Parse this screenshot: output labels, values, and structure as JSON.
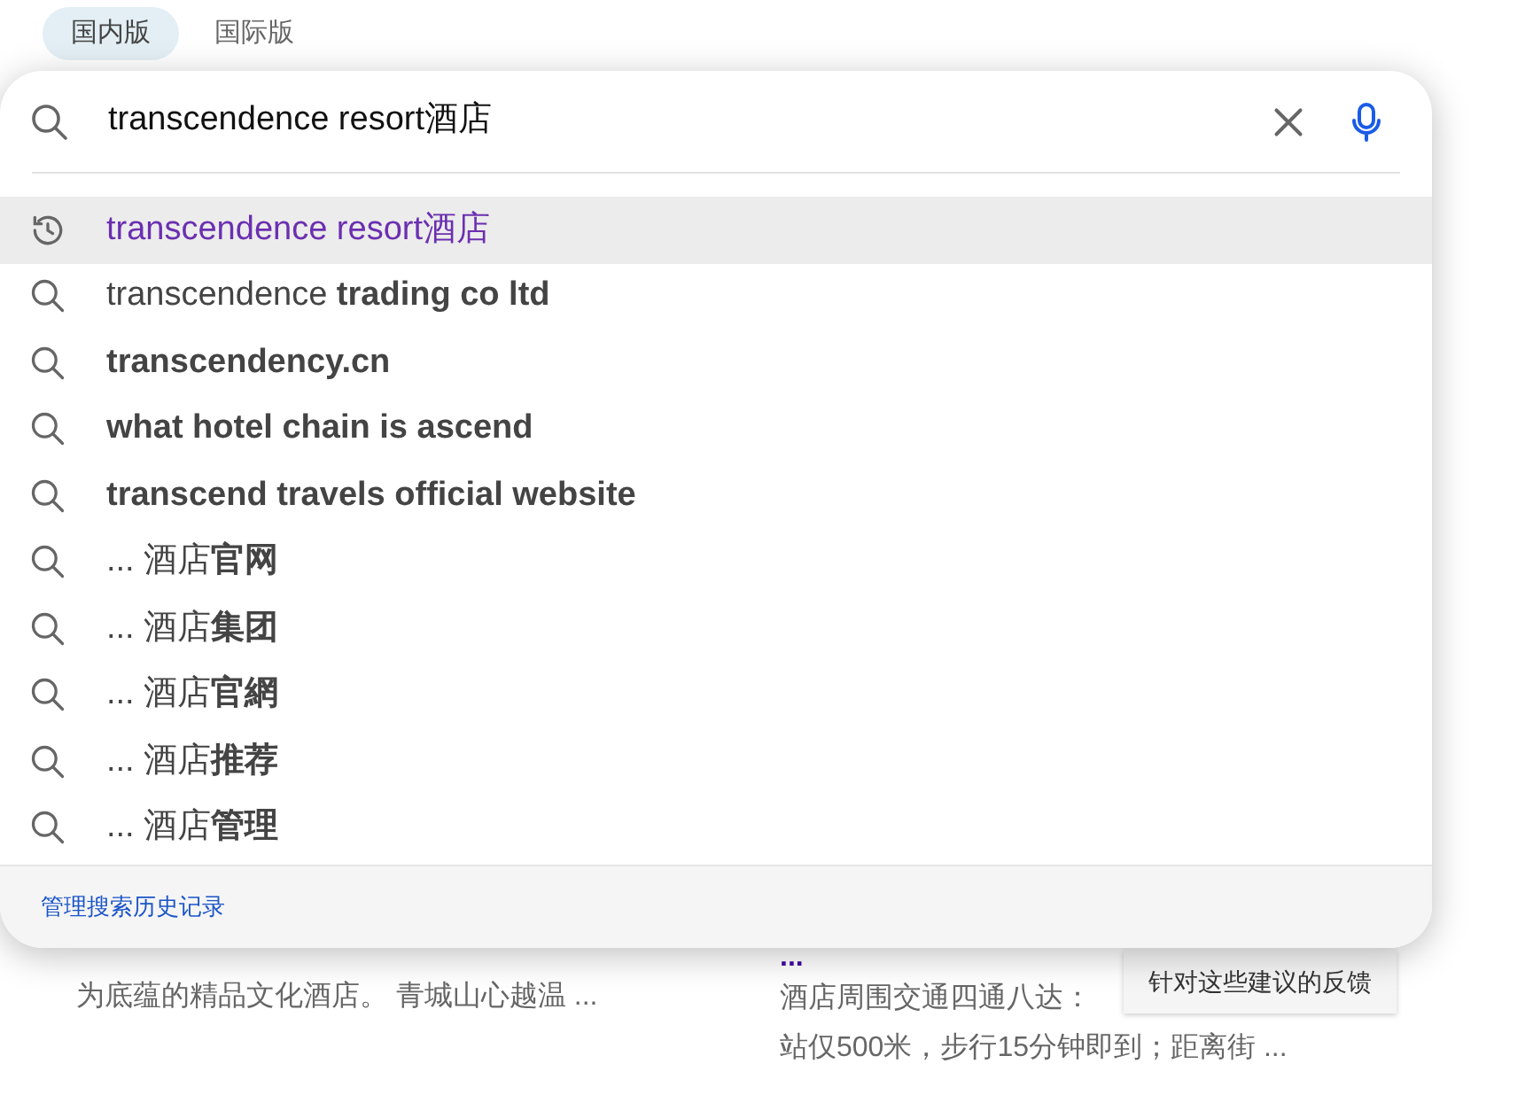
{
  "tabs": [
    {
      "label": "国内版",
      "selected": true
    },
    {
      "label": "国际版",
      "selected": false
    }
  ],
  "search": {
    "value": "transcendence resort酒店"
  },
  "suggestions": [
    {
      "kind": "history",
      "text": "transcendence resort酒店",
      "selected": true
    },
    {
      "kind": "search",
      "text": "transcendence **trading co ltd**",
      "selected": false
    },
    {
      "kind": "search",
      "text": "**transcendency.cn**",
      "selected": false
    },
    {
      "kind": "search",
      "text": "**what hotel chain is ascend**",
      "selected": false
    },
    {
      "kind": "search",
      "text": "**transcend travels official website**",
      "selected": false
    },
    {
      "kind": "search",
      "text": "... 酒店**官网**",
      "selected": false
    },
    {
      "kind": "search",
      "text": "... 酒店**集团**",
      "selected": false
    },
    {
      "kind": "search",
      "text": "... 酒店**官網**",
      "selected": false
    },
    {
      "kind": "search",
      "text": "... 酒店**推荐**",
      "selected": false
    },
    {
      "kind": "search",
      "text": "... 酒店**管理**",
      "selected": false
    }
  ],
  "footer_link": "管理搜索历史记录",
  "results": {
    "left_snippet": "为底蕴的精品文化酒店。 青城山心越温 ...",
    "right_title": "...",
    "right_snippet": [
      "酒店周围交通四通八达：",
      "站仅500米，步行15分钟即到；距离街 ..."
    ]
  },
  "feedback_tooltip": "针对这些建议的反馈"
}
